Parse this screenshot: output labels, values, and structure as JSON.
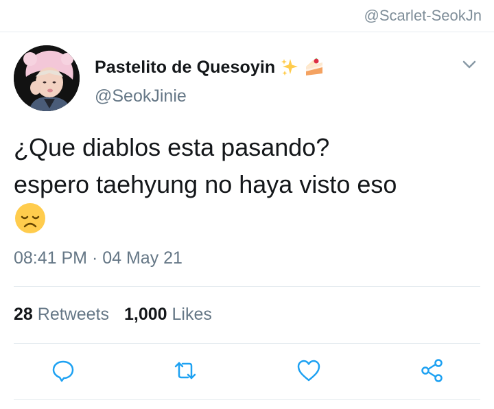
{
  "watermark": "@Scarlet-SeokJn",
  "author": {
    "display_name": "Pastelito de Quesoyin",
    "name_emojis": [
      "sparkles-icon",
      "shortcake-icon"
    ],
    "handle": "@SeokJinie"
  },
  "tweet": {
    "text_lines": [
      "¿Que diablos esta pasando?",
      "espero taehyung no haya visto eso"
    ],
    "trailing_emoji": "disappointed-face-icon",
    "timestamp": "08:41 PM · 04 May 21"
  },
  "stats": {
    "retweets_count": "28",
    "retweets_label": "Retweets",
    "likes_count": "1,000",
    "likes_label": "Likes"
  },
  "actions": [
    "reply-icon",
    "retweet-icon",
    "like-icon",
    "share-icon"
  ],
  "colors": {
    "text_primary": "#14171a",
    "text_secondary": "#657786",
    "divider": "#e6ecf0",
    "icon": "#1da1f2"
  }
}
